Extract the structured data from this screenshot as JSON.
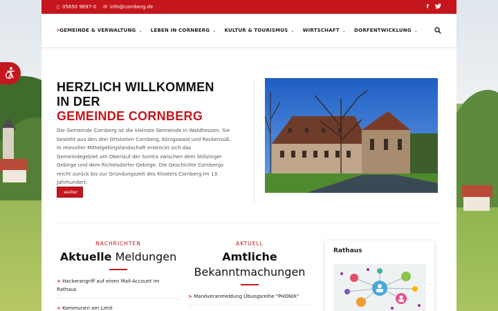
{
  "topbar": {
    "phone": "05650 9697-0",
    "email": "info@cornberg.de",
    "phone_icon": "phone-icon",
    "mail_icon": "mail-icon",
    "social": [
      "f",
      "t"
    ]
  },
  "nav": {
    "items": [
      {
        "label": "GEMEINDE & VERWALTUNG"
      },
      {
        "label": "LEBEN IN CORNBERG"
      },
      {
        "label": "KULTUR & TOURISMUS"
      },
      {
        "label": "WIRTSCHAFT"
      },
      {
        "label": "DORFENTWICKLUNG"
      }
    ],
    "search_icon": "search-icon"
  },
  "hero": {
    "title_line1": "HERZLICH WILLKOMMEN",
    "title_line2": "IN DER",
    "title_line3": "GEMEINDE CORNBERG",
    "text": "Die Gemeinde Cornberg ist die kleinste Gemeinde in Waldhessen. Sie besteht aus den drei Ortsteilen Cornberg, Königswald und Rockensüß. In reizvoller Mittelgebirgslandschaft erstreckt sich das Gemeindegebiet am Oberlauf der Sontra zwischen dem Stölzinger Gebirge und dem Richelsdorfer Gebirge. Die Geschichte Cornbergs reicht zurück bis zur Gründungszeit des Klosters Cornberg im 13. Jahrhundert.",
    "button": "weiter"
  },
  "news": {
    "kicker": "NACHRICHTEN",
    "title_bold": "Aktuelle",
    "title_rest": "Meldungen",
    "items": [
      "Hackerangriff auf einen Mail-Account im Rathaus",
      "Kommunen am Limit"
    ]
  },
  "notices": {
    "kicker": "AKTUELL",
    "title_bold": "Amtliche",
    "title_rest": "Bekanntmachungen",
    "items": [
      "Manöveranmeldung Übungsreihe \"PHONIX\""
    ]
  },
  "sidebar": {
    "title": "Rathaus"
  },
  "colors": {
    "brand": "#c4161c"
  }
}
